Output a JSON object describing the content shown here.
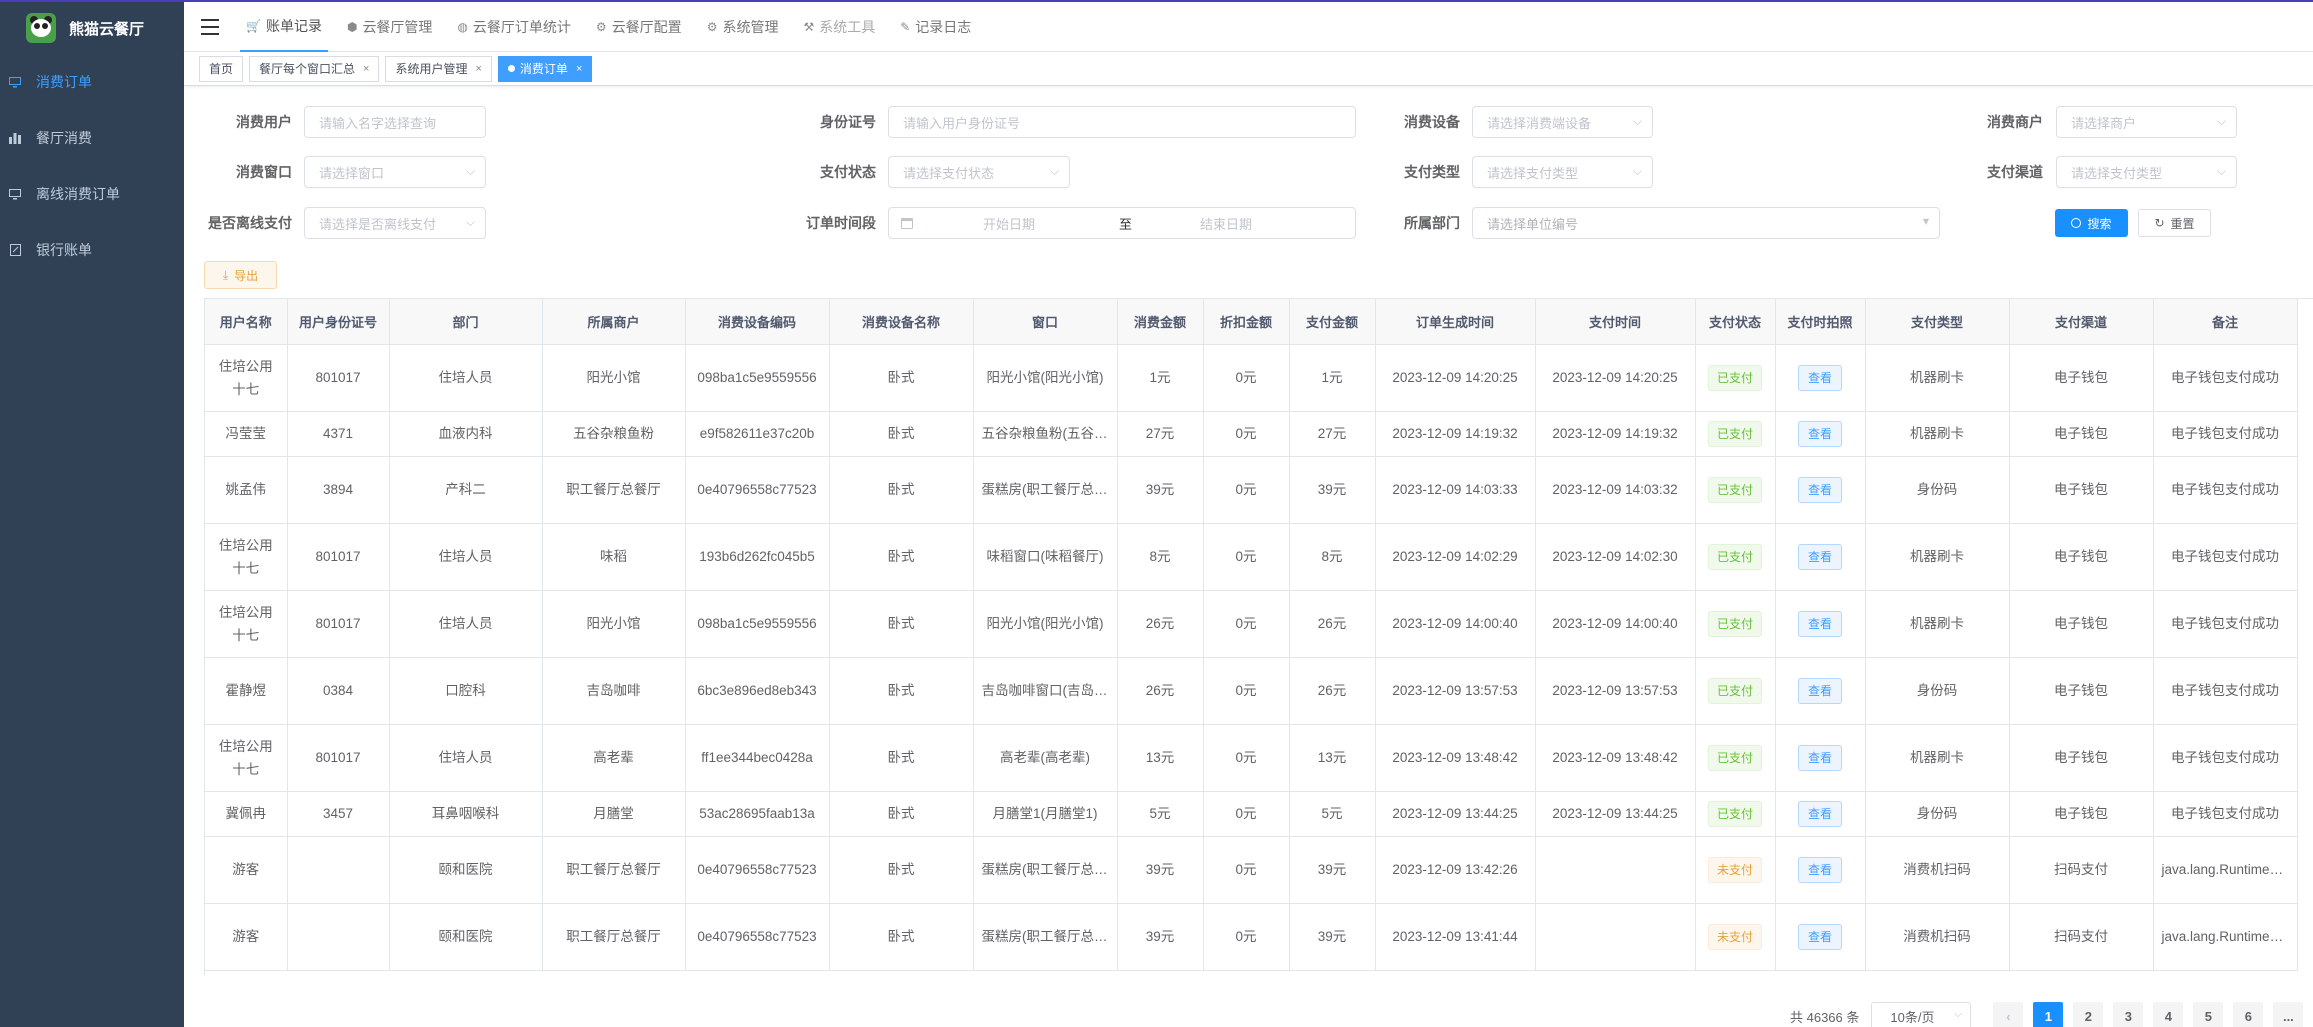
{
  "app": {
    "title": "熊猫云餐厅"
  },
  "sidebar": {
    "items": [
      {
        "label": "消费订单",
        "icon": "monitor-icon",
        "active": true
      },
      {
        "label": "餐厅消费",
        "icon": "bar-chart-icon",
        "active": false
      },
      {
        "label": "离线消费订单",
        "icon": "monitor-icon",
        "active": false
      },
      {
        "label": "银行账单",
        "icon": "edit-icon",
        "active": false
      }
    ]
  },
  "topnav": {
    "items": [
      {
        "label": "账单记录",
        "icon": "cart-icon",
        "active": true
      },
      {
        "label": "云餐厅管理",
        "icon": "cube-icon",
        "active": false
      },
      {
        "label": "云餐厅订单统计",
        "icon": "globe-icon",
        "active": false
      },
      {
        "label": "云餐厅配置",
        "icon": "gear-icon",
        "active": false
      },
      {
        "label": "系统管理",
        "icon": "gear-icon",
        "active": false
      },
      {
        "label": "系统工具",
        "icon": "tool-icon",
        "active": false,
        "disabled": true
      },
      {
        "label": "记录日志",
        "icon": "edit-icon",
        "active": false
      }
    ]
  },
  "tags": [
    {
      "label": "首页",
      "closable": false,
      "active": false
    },
    {
      "label": "餐厅每个窗口汇总",
      "closable": true,
      "active": false
    },
    {
      "label": "系统用户管理",
      "closable": true,
      "active": false
    },
    {
      "label": "消费订单",
      "closable": true,
      "active": true
    }
  ],
  "filters": {
    "user": {
      "label": "消费用户",
      "placeholder": "请输入名字选择查询"
    },
    "idcard": {
      "label": "身份证号",
      "placeholder": "请输入用户身份证号"
    },
    "device": {
      "label": "消费设备",
      "placeholder": "请选择消费端设备"
    },
    "merchant": {
      "label": "消费商户",
      "placeholder": "请选择商户"
    },
    "window": {
      "label": "消费窗口",
      "placeholder": "请选择窗口"
    },
    "paystatus": {
      "label": "支付状态",
      "placeholder": "请选择支付状态"
    },
    "paytype": {
      "label": "支付类型",
      "placeholder": "请选择支付类型"
    },
    "channel": {
      "label": "支付渠道",
      "placeholder": "请选择支付类型"
    },
    "offline": {
      "label": "是否离线支付",
      "placeholder": "请选择是否离线支付"
    },
    "period": {
      "label": "订单时间段",
      "start": "开始日期",
      "sep": "至",
      "end": "结束日期"
    },
    "dept": {
      "label": "所属部门",
      "placeholder": "请选择单位编号"
    }
  },
  "buttons": {
    "search": "搜索",
    "reset": "重置",
    "export": "导出"
  },
  "table": {
    "columns": [
      "用户名称",
      "用户身份证号",
      "部门",
      "所属商户",
      "消费设备编码",
      "消费设备名称",
      "窗口",
      "消费金额",
      "折扣金额",
      "支付金额",
      "订单生成时间",
      "支付时间",
      "支付状态",
      "支付时拍照",
      "支付类型",
      "支付渠道",
      "备注"
    ],
    "view_label": "查看",
    "rows": [
      {
        "name": "住培公用十七",
        "id": "801017",
        "dept": "住培人员",
        "merchant": "阳光小馆",
        "code": "098ba1c5e9559556",
        "dev": "卧式",
        "window": "阳光小馆(阳光小馆)",
        "amount": "1元",
        "discount": "0元",
        "paid": "1元",
        "created": "2023-12-09 14:20:25",
        "paytime": "2023-12-09 14:20:25",
        "status": "已支付",
        "paid_flag": true,
        "type": "机器刷卡",
        "channel": "电子钱包",
        "remark": "电子钱包支付成功"
      },
      {
        "name": "冯莹莹",
        "id": "4371",
        "dept": "血液内科",
        "merchant": "五谷杂粮鱼粉",
        "code": "e9f582611e37c20b",
        "dev": "卧式",
        "window": "五谷杂粮鱼粉(五谷杂粮鱼粉)",
        "amount": "27元",
        "discount": "0元",
        "paid": "27元",
        "created": "2023-12-09 14:19:32",
        "paytime": "2023-12-09 14:19:32",
        "status": "已支付",
        "paid_flag": true,
        "type": "机器刷卡",
        "channel": "电子钱包",
        "remark": "电子钱包支付成功"
      },
      {
        "name": "姚孟伟",
        "id": "3894",
        "dept": "产科二",
        "merchant": "职工餐厅总餐厅",
        "code": "0e40796558c77523",
        "dev": "卧式",
        "window": "蛋糕房(职工餐厅总餐厅)",
        "amount": "39元",
        "discount": "0元",
        "paid": "39元",
        "created": "2023-12-09 14:03:33",
        "paytime": "2023-12-09 14:03:32",
        "status": "已支付",
        "paid_flag": true,
        "type": "身份码",
        "channel": "电子钱包",
        "remark": "电子钱包支付成功"
      },
      {
        "name": "住培公用十七",
        "id": "801017",
        "dept": "住培人员",
        "merchant": "味稻",
        "code": "193b6d262fc045b5",
        "dev": "卧式",
        "window": "味稻窗口(味稻餐厅)",
        "amount": "8元",
        "discount": "0元",
        "paid": "8元",
        "created": "2023-12-09 14:02:29",
        "paytime": "2023-12-09 14:02:30",
        "status": "已支付",
        "paid_flag": true,
        "type": "机器刷卡",
        "channel": "电子钱包",
        "remark": "电子钱包支付成功"
      },
      {
        "name": "住培公用十七",
        "id": "801017",
        "dept": "住培人员",
        "merchant": "阳光小馆",
        "code": "098ba1c5e9559556",
        "dev": "卧式",
        "window": "阳光小馆(阳光小馆)",
        "amount": "26元",
        "discount": "0元",
        "paid": "26元",
        "created": "2023-12-09 14:00:40",
        "paytime": "2023-12-09 14:00:40",
        "status": "已支付",
        "paid_flag": true,
        "type": "机器刷卡",
        "channel": "电子钱包",
        "remark": "电子钱包支付成功"
      },
      {
        "name": "霍静煜",
        "id": "0384",
        "dept": "口腔科",
        "merchant": "吉岛咖啡",
        "code": "6bc3e896ed8eb343",
        "dev": "卧式",
        "window": "吉岛咖啡窗口(吉岛咖啡)",
        "amount": "26元",
        "discount": "0元",
        "paid": "26元",
        "created": "2023-12-09 13:57:53",
        "paytime": "2023-12-09 13:57:53",
        "status": "已支付",
        "paid_flag": true,
        "type": "身份码",
        "channel": "电子钱包",
        "remark": "电子钱包支付成功"
      },
      {
        "name": "住培公用十七",
        "id": "801017",
        "dept": "住培人员",
        "merchant": "高老辈",
        "code": "ff1ee344bec0428a",
        "dev": "卧式",
        "window": "高老辈(高老辈)",
        "amount": "13元",
        "discount": "0元",
        "paid": "13元",
        "created": "2023-12-09 13:48:42",
        "paytime": "2023-12-09 13:48:42",
        "status": "已支付",
        "paid_flag": true,
        "type": "机器刷卡",
        "channel": "电子钱包",
        "remark": "电子钱包支付成功"
      },
      {
        "name": "冀佩冉",
        "id": "3457",
        "dept": "耳鼻咽喉科",
        "merchant": "月膳堂",
        "code": "53ac28695faab13a",
        "dev": "卧式",
        "window": "月膳堂1(月膳堂1)",
        "amount": "5元",
        "discount": "0元",
        "paid": "5元",
        "created": "2023-12-09 13:44:25",
        "paytime": "2023-12-09 13:44:25",
        "status": "已支付",
        "paid_flag": true,
        "type": "身份码",
        "channel": "电子钱包",
        "remark": "电子钱包支付成功"
      },
      {
        "name": "游客",
        "id": "",
        "dept": "颐和医院",
        "merchant": "职工餐厅总餐厅",
        "code": "0e40796558c77523",
        "dev": "卧式",
        "window": "蛋糕房(职工餐厅总餐厅)",
        "amount": "39元",
        "discount": "0元",
        "paid": "39元",
        "created": "2023-12-09 13:42:26",
        "paytime": "",
        "status": "未支付",
        "paid_flag": false,
        "type": "消费机扫码",
        "channel": "扫码支付",
        "remark": "java.lang.RuntimeException"
      },
      {
        "name": "游客",
        "id": "",
        "dept": "颐和医院",
        "merchant": "职工餐厅总餐厅",
        "code": "0e40796558c77523",
        "dev": "卧式",
        "window": "蛋糕房(职工餐厅总餐厅)",
        "amount": "39元",
        "discount": "0元",
        "paid": "39元",
        "created": "2023-12-09 13:41:44",
        "paytime": "",
        "status": "未支付",
        "paid_flag": false,
        "type": "消费机扫码",
        "channel": "扫码支付",
        "remark": "java.lang.RuntimeException"
      }
    ]
  },
  "pager": {
    "total_text": "共 46366 条",
    "page_size": "10条/页",
    "pages": [
      "1",
      "2",
      "3",
      "4",
      "5",
      "6",
      "..."
    ],
    "current": "1"
  }
}
